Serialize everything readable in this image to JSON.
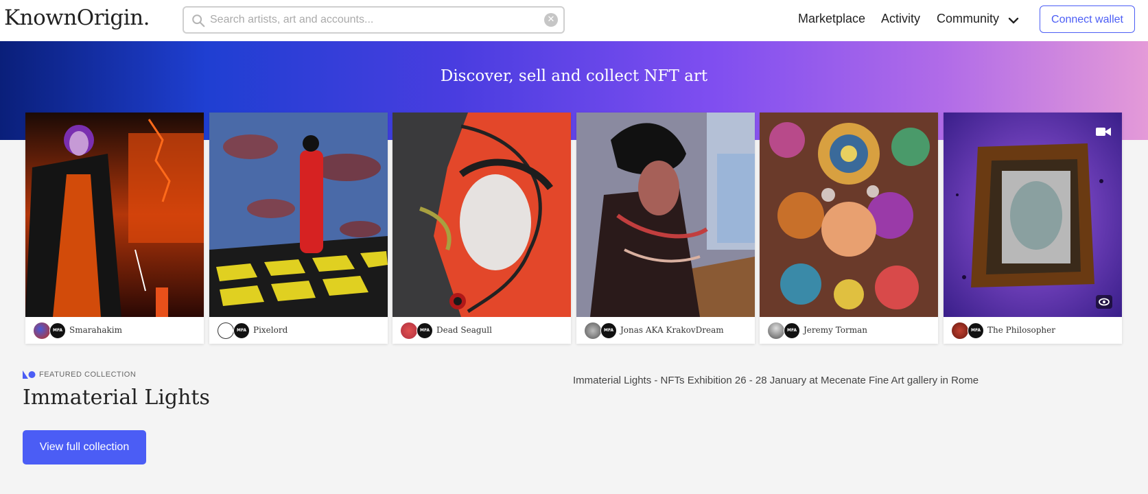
{
  "header": {
    "logo": "KnownOrigin.",
    "search_placeholder": "Search artists, art and accounts...",
    "nav": {
      "marketplace": "Marketplace",
      "activity": "Activity",
      "community": "Community"
    },
    "connect_label": "Connect wallet"
  },
  "hero": {
    "title": "Discover, sell and collect NFT art"
  },
  "cards": [
    {
      "artist": "Smarahakim",
      "badge": "MFA"
    },
    {
      "artist": "Pixelord",
      "badge": "MFA"
    },
    {
      "artist": "Dead Seagull",
      "badge": "MFA"
    },
    {
      "artist": "Jonas AKA KrakovDream",
      "badge": "MFA"
    },
    {
      "artist": "Jeremy Torman",
      "badge": "MFA"
    },
    {
      "artist": "The Philosopher",
      "badge": "MFA"
    }
  ],
  "featured": {
    "label": "FEATURED COLLECTION",
    "title": "Immaterial Lights",
    "description": "Immaterial Lights - NFTs Exhibition 26 - 28 January at Mecenate Fine Art gallery in Rome",
    "button_label": "View full collection"
  },
  "colors": {
    "accent": "#4b5df5"
  }
}
